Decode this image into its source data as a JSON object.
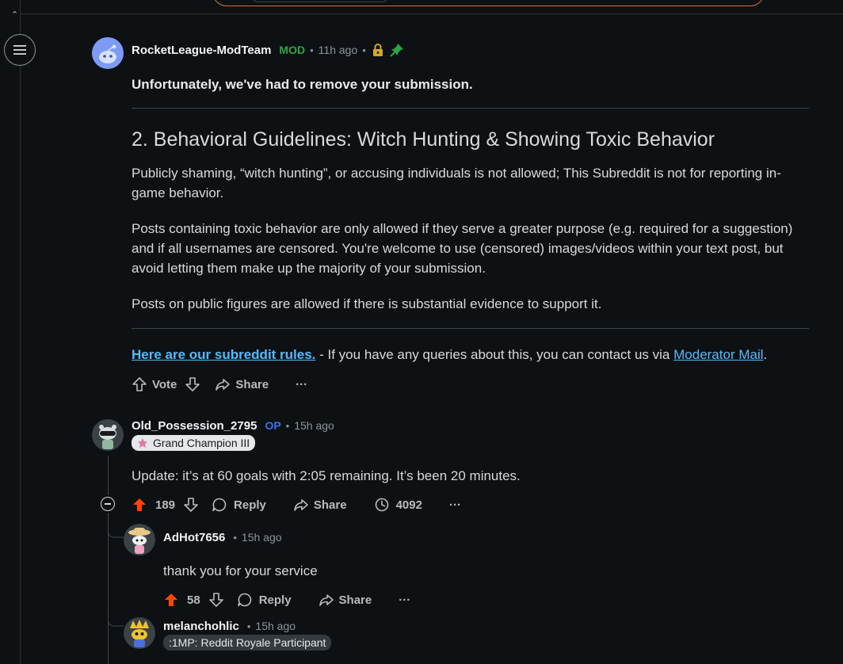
{
  "colors": {
    "background": "#0e1113",
    "mod_green": "#28a745",
    "op_blue": "#3b6ff2",
    "link_blue": "#4fbcff",
    "upvote_orange": "#ff4500"
  },
  "mod_comment": {
    "author": "RocketLeague-ModTeam",
    "tag": "MOD",
    "time": "11h ago",
    "title": "Unfortunately, we've had to remove your submission.",
    "heading": "2. Behavioral Guidelines: Witch Hunting & Showing Toxic Behavior",
    "para1": "Publicly shaming, “witch hunting”, or accusing individuals is not allowed; This Subreddit is not for reporting in-game behavior.",
    "para2": "Posts containing toxic behavior are only allowed if they serve a greater purpose (e.g. required for a suggestion) and if all usernames are censored. You're welcome to use (censored) images/videos within your text post, but avoid letting them make up the majority of your submission.",
    "para3": "Posts on public figures are allowed if there is substantial evidence to support it.",
    "rules_link": "Here are our subreddit rules.",
    "rules_suffix": " - If you have any queries about this, you can contact us via ",
    "modmail_link": "Moderator Mail",
    "period": ".",
    "actions": {
      "vote": "Vote",
      "share": "Share",
      "more": "···"
    }
  },
  "op_comment": {
    "author": "Old_Possession_2795",
    "tag": "OP",
    "time": "15h ago",
    "flair": "Grand Champion III",
    "text": "Update: it’s at 60 goals with 2:05 remaining. It’s been 20 minutes.",
    "votes": "189",
    "reply": "Reply",
    "share": "Share",
    "views": "4092",
    "more": "···"
  },
  "reply1": {
    "author": "AdHot7656",
    "time": "15h ago",
    "text": "thank you for your service",
    "votes": "58",
    "reply": "Reply",
    "share": "Share",
    "more": "···"
  },
  "reply2": {
    "author": "melanchohlic",
    "time": "15h ago",
    "flair": ":1MP: Reddit Royale Participant"
  }
}
